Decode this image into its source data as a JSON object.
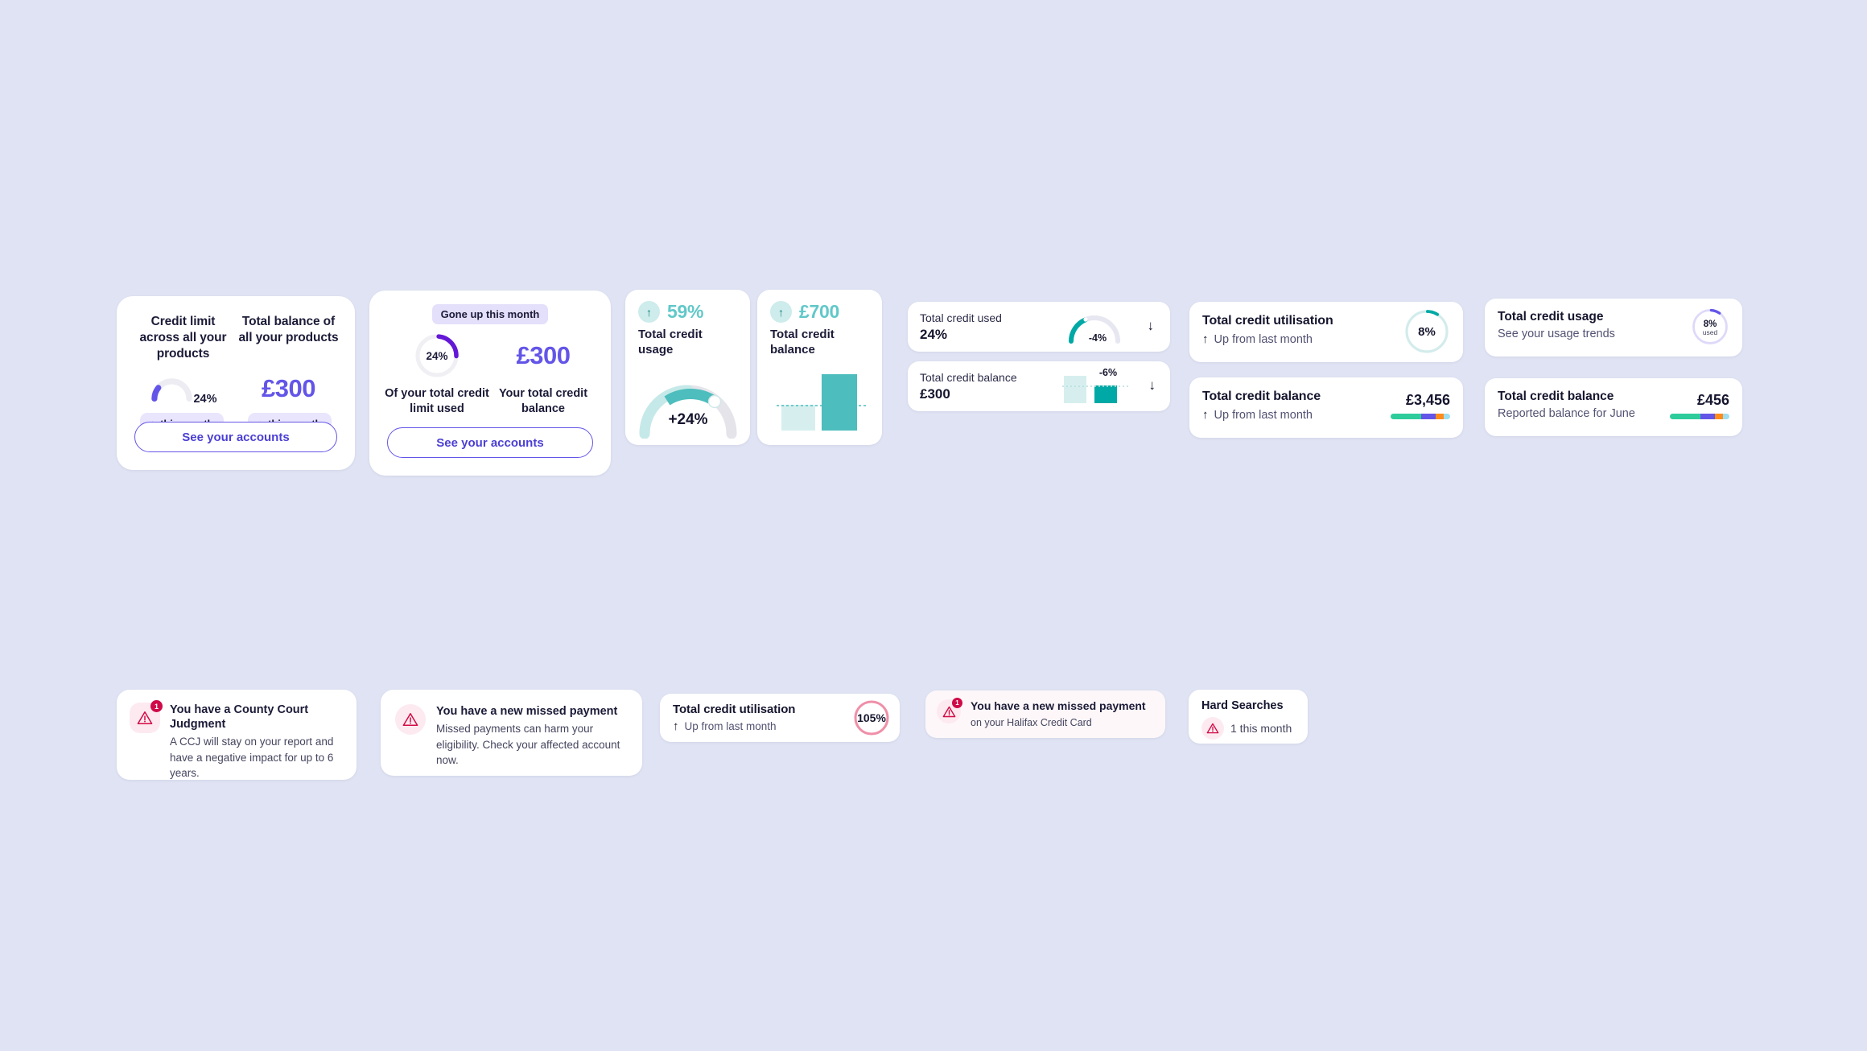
{
  "theme": {
    "page_bg": "#dfe3f3",
    "purple": "#6355e8",
    "purple_dark": "#4b3fd4",
    "teal": "#00a9a5",
    "teal_mid": "#4dbdbd",
    "teal_light": "#c5e9e8",
    "grey_track": "#e6e6ef",
    "rose": "#e8708f",
    "red": "#cf0a48",
    "pink_bg": "#fdeaf0"
  },
  "card1": {
    "name": "credit-overview-card",
    "left_heading": "Credit limit across all your products",
    "right_heading": "Total balance of all your products",
    "gauge_value": "24%",
    "gauge_percent": 24,
    "balance": "£300",
    "left_pill": {
      "arrow": "↓",
      "text": "this month"
    },
    "right_pill": {
      "arrow": "↑",
      "text": "this month"
    },
    "cta": "See your accounts"
  },
  "card2": {
    "name": "credit-usage-card",
    "badge": "Gone up this month",
    "ring_value": "24%",
    "ring_percent": 24,
    "balance": "£300",
    "left_caption": "Of your total credit limit used",
    "right_caption": "Your total credit balance",
    "cta": "See your accounts"
  },
  "card3": {
    "name": "total-credit-usage-gauge-card",
    "trend_arrow": "↑",
    "headline": "59%",
    "label": "Total credit usage",
    "gauge_text": "+24%",
    "gauge_light_percent": 40,
    "gauge_solid_percent": 59
  },
  "card4": {
    "name": "total-credit-balance-bars-card",
    "trend_arrow": "↑",
    "headline": "£700",
    "label": "Total credit balance",
    "bars": [
      {
        "name": "previous",
        "height_pct": 42,
        "color": "#d6efee"
      },
      {
        "name": "current",
        "height_pct": 100,
        "color": "#4dbdbd"
      }
    ]
  },
  "card5a": {
    "name": "total-credit-used-row",
    "title": "Total credit used",
    "value": "24%",
    "delta": "-4%",
    "delta_arrow": "↓",
    "gauge_percent": 30
  },
  "card5b": {
    "name": "total-credit-balance-row",
    "title": "Total credit balance",
    "value": "£300",
    "delta": "-6%",
    "delta_arrow": "↓"
  },
  "card6a": {
    "name": "total-credit-utilisation-ring-card",
    "title": "Total credit utilisation",
    "sub_arrow": "↑",
    "sub": "Up from last month",
    "ring_value": "8%",
    "ring_percent": 8
  },
  "card6b": {
    "name": "total-credit-balance-segbar-card",
    "title": "Total credit balance",
    "sub_arrow": "↑",
    "sub": "Up from last month",
    "value": "£3,456",
    "segments": [
      {
        "color": "#2ecc9b",
        "width_pct": 52
      },
      {
        "color": "#6355e8",
        "width_pct": 24
      },
      {
        "color": "#ff8c1a",
        "width_pct": 13
      },
      {
        "color": "#9fdef0",
        "width_pct": 11
      }
    ]
  },
  "card7a": {
    "name": "total-credit-usage-ring-card",
    "title": "Total credit usage",
    "sub": "See your usage trends",
    "ring_value": "8%",
    "ring_unit": "used",
    "ring_percent": 8
  },
  "card7b": {
    "name": "total-credit-balance-reported-card",
    "title": "Total credit balance",
    "sub": "Reported balance for June",
    "value": "£456",
    "segments": [
      {
        "color": "#2ecc9b",
        "width_pct": 52
      },
      {
        "color": "#6355e8",
        "width_pct": 24
      },
      {
        "color": "#ff8c1a",
        "width_pct": 13
      },
      {
        "color": "#9fdef0",
        "width_pct": 11
      }
    ]
  },
  "alert1": {
    "name": "ccj-alert-card",
    "badge_count": "1",
    "title": "You have a County Court Judgment",
    "body": "A CCJ will stay on your report and have a negative impact for up to 6 years."
  },
  "alert2": {
    "name": "missed-payment-alert-card",
    "title": "You have a new missed payment",
    "body": "Missed payments can harm your eligibility. Check your affected account now."
  },
  "alert3": {
    "name": "utilisation-over-limit-card",
    "title": "Total credit utilisation",
    "sub_arrow": "↑",
    "sub": "Up from last month",
    "ring_value": "105%"
  },
  "alert4": {
    "name": "missed-payment-compact-card",
    "badge_count": "1",
    "title": "You have a new missed payment",
    "sub": "on your Halifax Credit Card"
  },
  "alert5": {
    "name": "hard-searches-card",
    "title": "Hard Searches",
    "value": "1 this month"
  }
}
